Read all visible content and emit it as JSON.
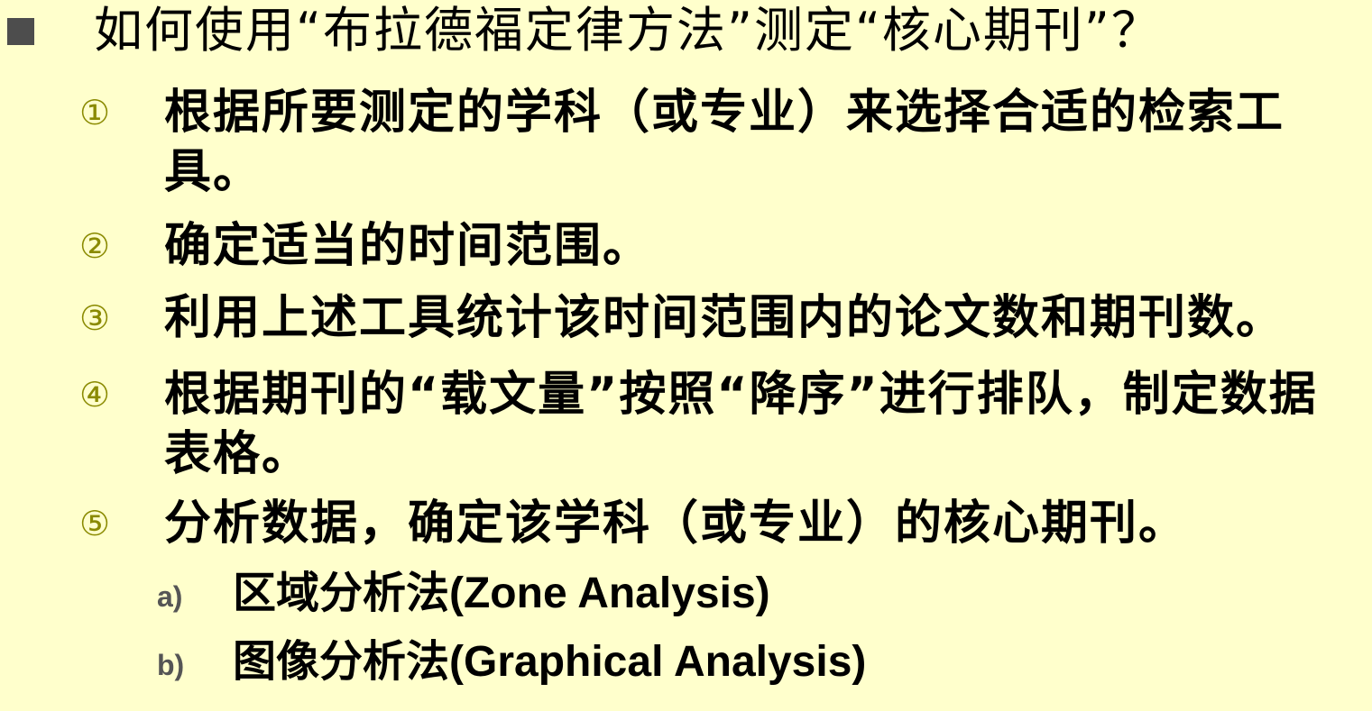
{
  "heading": "如何使用“布拉德福定律方法”测定“核心期刊”？",
  "steps": [
    {
      "marker": "①",
      "text": "根据所要测定的学科（或专业）来选择合适的检索工具。"
    },
    {
      "marker": "②",
      "text": "确定适当的时间范围。"
    },
    {
      "marker": "③",
      "text": "利用上述工具统计该时间范围内的论文数和期刊数。"
    },
    {
      "marker": "④",
      "text": "根据期刊的“载文量”按照“降序”进行排队，制定数据表格。"
    },
    {
      "marker": "⑤",
      "text": "分析数据，确定该学科（或专业）的核心期刊。"
    }
  ],
  "methods": [
    {
      "marker": "a)",
      "text": "区域分析法(Zone Analysis)"
    },
    {
      "marker": "b)",
      "text": "图像分析法(Graphical Analysis)"
    }
  ],
  "colors": {
    "background": "#ffffcc",
    "bullet": "#4d4d4d",
    "step_marker": "#8a8a00",
    "sub_marker": "#555555"
  },
  "icons": {
    "heading_bullet": "square-bullet-icon"
  }
}
